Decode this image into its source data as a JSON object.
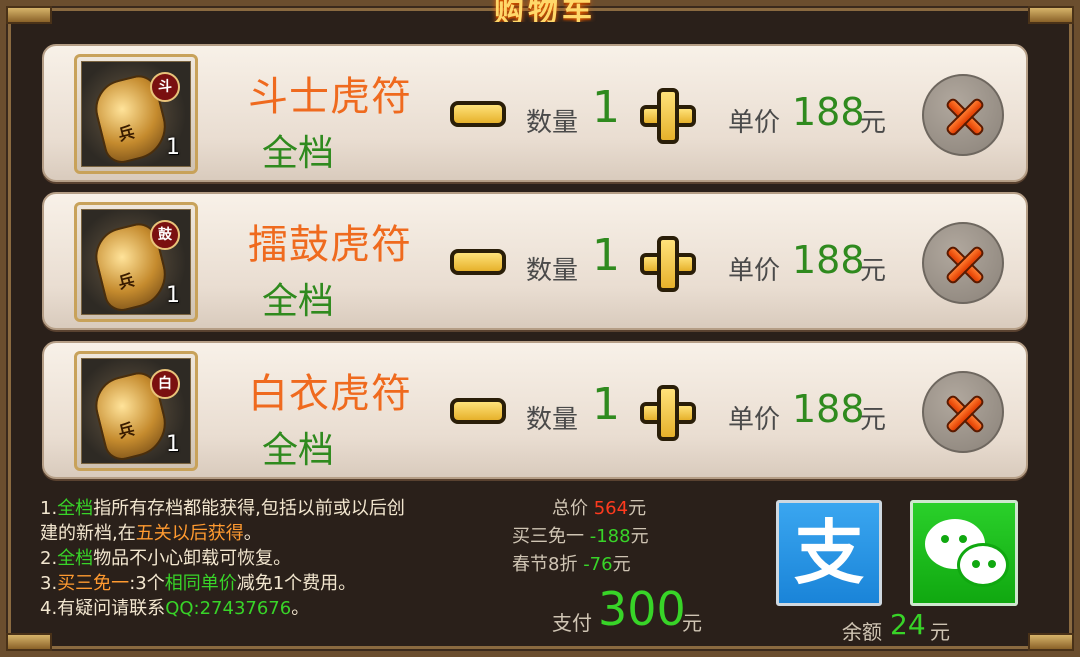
{
  "header": {
    "title": "购物车"
  },
  "items": [
    {
      "seal": "斗",
      "icon_char": "兵",
      "count": "1",
      "name": "斗士虎符",
      "tag": "全档",
      "qty_label": "数量",
      "qty": "1",
      "price_label": "单价",
      "price": "188",
      "price_unit": "元"
    },
    {
      "seal": "鼓",
      "icon_char": "兵",
      "count": "1",
      "name": "擂鼓虎符",
      "tag": "全档",
      "qty_label": "数量",
      "qty": "1",
      "price_label": "单价",
      "price": "188",
      "price_unit": "元"
    },
    {
      "seal": "白",
      "icon_char": "兵",
      "count": "1",
      "name": "白衣虎符",
      "tag": "全档",
      "qty_label": "数量",
      "qty": "1",
      "price_label": "单价",
      "price": "188",
      "price_unit": "元"
    }
  ],
  "notes": {
    "l1_prefix": "1.",
    "l1_hl": "全档",
    "l1_text": "指所有存档都能获得,包括以前或以后创",
    "l2_text": "建的新档,在",
    "l2_hl": "五关以后获得",
    "l2_end": "。",
    "l3_prefix": "2.",
    "l3_hl": "全档",
    "l3_text": "物品不小心卸载可恢复。",
    "l4_prefix": "3.",
    "l4_hl": "买三免一",
    "l4_text": ":3个",
    "l4_hl2": "相同单价",
    "l4_text2": "减免1个费用。",
    "l5_text": "4.有疑问请联系",
    "l5_hl": "QQ:27437676",
    "l5_end": "。"
  },
  "summary": {
    "total_label": "总价",
    "total_value": "564",
    "total_unit": "元",
    "discount_label": "买三免一",
    "discount_value": "-188",
    "discount_unit": "元",
    "festival_label": "春节8折",
    "festival_value": "-76",
    "festival_unit": "元",
    "pay_label": "支付",
    "pay_value": "300",
    "pay_unit": "元"
  },
  "payment": {
    "alipay_glyph": "支"
  },
  "balance": {
    "label": "余额",
    "value": "24",
    "unit": "元"
  },
  "colors": {
    "accent_green": "#38d428",
    "name_orange": "#ef6a1e",
    "total_red": "#ff3a1e"
  }
}
